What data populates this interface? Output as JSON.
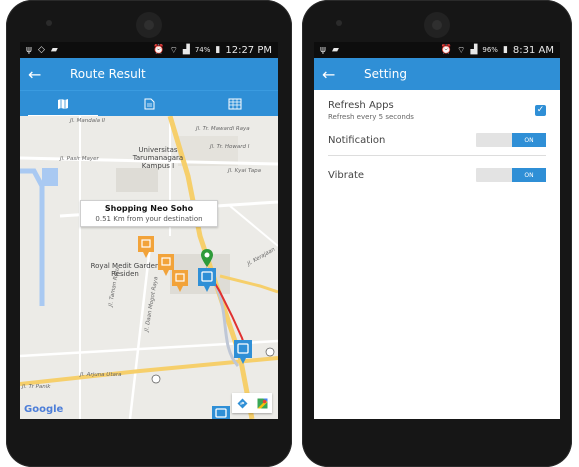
{
  "left_phone": {
    "status": {
      "time": "12:27 PM",
      "battery": "74%"
    },
    "appbar": {
      "back_icon": "arrow-back-icon",
      "title": "Route Result"
    },
    "tabs": [
      {
        "icon": "map-icon",
        "active": true
      },
      {
        "icon": "document-icon",
        "active": false
      },
      {
        "icon": "calendar-grid-icon",
        "active": false
      }
    ],
    "map": {
      "streets": {
        "s1": "Jl. Mandala II",
        "s2": "Jl. Tr. Mawardi Raya",
        "s3": "Jl. Pasir Mayer",
        "s4": "Jl. Tr. Howard I",
        "s5": "Jl. Kyai Tapa",
        "s6": "Jl. Kerajaan",
        "s7": "Jl. Arjuna Utara",
        "s8": "Jl. Tr Panik",
        "s9": "Jl. Daan Mogot Raya",
        "s10": "Jl. Taman Ratu"
      },
      "poi_university": "Universitas Tarumanagara Kampus I",
      "poi_residence": "Royal Medit Garden Residen",
      "info_title": "Shopping Neo Soho",
      "info_subtitle": "0.51 Km from your destination",
      "google_label": "Google"
    }
  },
  "right_phone": {
    "status": {
      "time": "8:31 AM",
      "battery": "96%"
    },
    "appbar": {
      "back_icon": "arrow-back-icon",
      "title": "Setting"
    },
    "settings": {
      "refresh_label": "Refresh Apps",
      "refresh_sub": "Refresh every 5 seconds",
      "notification_label": "Notification",
      "notification_toggle": "ON",
      "vibrate_label": "Vibrate",
      "vibrate_toggle": "ON"
    }
  },
  "colors": {
    "primary": "#2f8fd6",
    "route": "#e03030",
    "marker_orange": "#f2a33a",
    "marker_blue": "#2f8fd6",
    "marker_green": "#2e9b3a"
  }
}
